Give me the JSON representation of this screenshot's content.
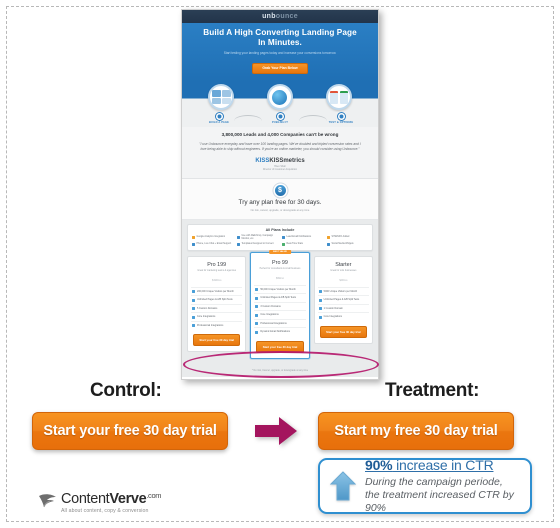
{
  "mockup": {
    "brand": "unbounce",
    "brand_dim_part": "ounce",
    "hero": {
      "headline_line1": "Build A High Converting Landing Page",
      "headline_line2": "In Minutes.",
      "subhead": "Start testing your landing pages today and increase your conversions tomorrow.",
      "cta": "Grab Your Plan Below"
    },
    "steps": [
      {
        "label": "BUILD A PAGE",
        "icon": "page-thumbnails-icon"
      },
      {
        "label": "PUBLISH IT",
        "icon": "globe-icon"
      },
      {
        "label": "TEST & OPTIMIZE",
        "icon": "ab-test-icon"
      }
    ],
    "proof": {
      "headline": "3,800,000 Leads and 4,000 Companies can't be wrong",
      "quote": "\"I use Unbounce everyday and have over 100 landing pages. We've doubled and tripled conversion rates and I love being able to ship without engineers. If you're an online marketer, you should consider using Unbounce.\"",
      "logo": "KISSmetrics",
      "logo_sub": "Hiten Shah",
      "logo_sub2": "Director of Customer Acquisition"
    },
    "trial": {
      "coin_icon": "dollar-coin-icon",
      "headline": "Try any plan free for 30 days.",
      "subhead": "No risk, cancel, upgrade, or downgrade at any time"
    },
    "all_plans": {
      "title": "All Plans Include",
      "features": [
        {
          "label": "Google Analytics Integration",
          "color": "#f0a22c"
        },
        {
          "label": "Use with Mailchimp, Campaign Monitor, etc.",
          "color": "#3f8ecb"
        },
        {
          "label": "Lead Email Notifications",
          "color": "#3f8ecb"
        },
        {
          "label": "SITEINFO Added",
          "color": "#f0a22c"
        },
        {
          "label": "Phone, Live Chat + Email Support",
          "color": "#3f8ecb"
        },
        {
          "label": "Templates Designed to Convert",
          "color": "#3f8ecb"
        },
        {
          "label": "Real-Time Stats",
          "color": "#4caf6e"
        },
        {
          "label": "Social Media Widgets",
          "color": "#3f8ecb"
        }
      ]
    },
    "tiers": [
      {
        "badge": "",
        "name": "Pro 199",
        "desc": "Great for marketing teams & agencies",
        "price": "$199",
        "price_unit": "/mo",
        "features": [
          {
            "title": "200,000 Unique Visitors per Month",
            "sub": ""
          },
          {
            "title": "Unlimited Pages & A/B Split Tests",
            "sub": ""
          },
          {
            "title": "5 Custom Domains",
            "sub": "Add a look up your own host"
          },
          {
            "title": "Core Integrations",
            "sub": "Mailchimp, Marketo, Hubspot, etc."
          },
          {
            "title": "Professional Integrations",
            "sub": "Salesforce, Marketo, etc."
          }
        ],
        "cta": "Start your free 30 day trial"
      },
      {
        "badge": "BEST VALUE",
        "name": "Pro 99",
        "desc": "Perfect for consultants & small business",
        "price": "$99",
        "price_unit": "/mo",
        "features": [
          {
            "title": "50,000 Unique Visitors per Month",
            "sub": ""
          },
          {
            "title": "Unlimited Pages & A/B Split Tests",
            "sub": ""
          },
          {
            "title": "3 Custom Domains",
            "sub": "Add a look up your own host"
          },
          {
            "title": "Core Integrations",
            "sub": "Mailchimp, Marketo, Hubspot, etc."
          },
          {
            "title": "Professional Integrations",
            "sub": "Salesforce, Marketo, etc."
          },
          {
            "title": "Dynamic Email Notifications",
            "sub": ""
          }
        ],
        "cta": "Start your free 30 day trial"
      },
      {
        "badge": "",
        "name": "Starter",
        "desc": "Great for solo businesses",
        "price": "$49",
        "price_unit": "/mo",
        "features": [
          {
            "title": "5000 Unique Visitors per Month",
            "sub": ""
          },
          {
            "title": "Unlimited Pages & A/B Split Tests",
            "sub": ""
          },
          {
            "title": "1 Custom Domain",
            "sub": "Add a look up your own host"
          },
          {
            "title": "Core Integrations",
            "sub": "Mailchimp, Marketo, Hubspot, etc."
          }
        ],
        "cta": "Start your free 30 day trial"
      }
    ],
    "footer_note": "* No risk, Cancel, upgrade, or downgrade at any time"
  },
  "comparison": {
    "control_label": "Control:",
    "control_cta": "Start your free 30 day trial",
    "arrow_icon": "right-arrow-icon",
    "treatment_label": "Treatment:",
    "treatment_cta": "Start my free 30 day trial"
  },
  "result": {
    "arrow_icon": "up-arrow-icon",
    "metric": "90%",
    "metric_rest": " increase in CTR",
    "description": "During the campaign periode, the treatment increased CTR by 90%"
  },
  "footer": {
    "logo_icon": "contentverve-bird-icon",
    "name_first": "Content",
    "name_second": "Verve",
    "domain": ".com",
    "tagline": "All about content, copy & conversion"
  },
  "colors": {
    "cta_orange": "#ea760f",
    "highlight_magenta": "#b4186b",
    "accent_blue": "#2f8fd0",
    "hero_blue": "#1f6fb4"
  }
}
